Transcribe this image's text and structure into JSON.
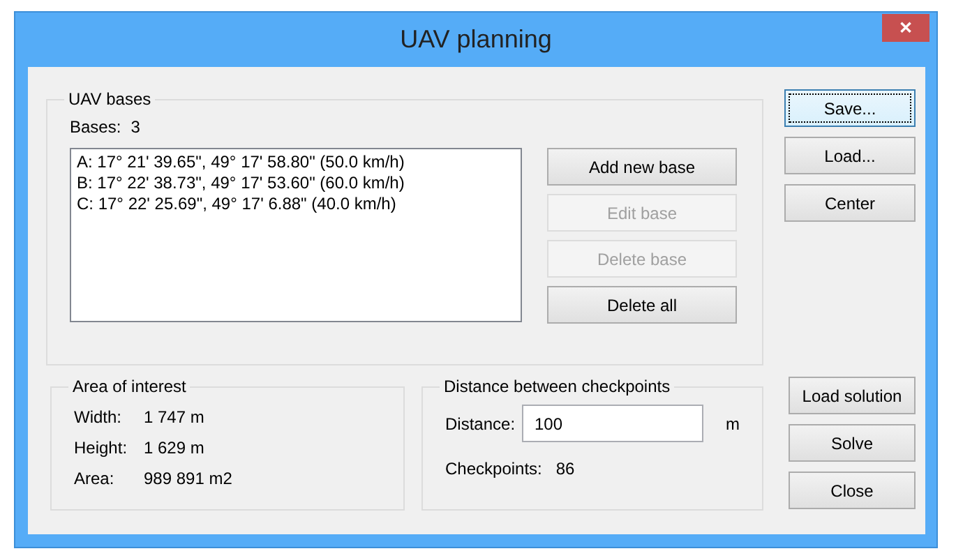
{
  "window": {
    "title": "UAV planning",
    "close": "✕"
  },
  "bases_group": {
    "title": "UAV bases",
    "count_label": "Bases:",
    "count": "3",
    "items": [
      "A: 17° 21' 39.65\", 49° 17' 58.80\" (50.0 km/h)",
      "B: 17° 22' 38.73\", 49° 17' 53.60\" (60.0 km/h)",
      "C: 17° 22' 25.69\", 49° 17' 6.88\" (40.0 km/h)"
    ],
    "buttons": [
      {
        "label": "Add new base",
        "disabled": false
      },
      {
        "label": "Edit base",
        "disabled": true
      },
      {
        "label": "Delete base",
        "disabled": true
      },
      {
        "label": "Delete all",
        "disabled": false
      }
    ]
  },
  "side_buttons": [
    {
      "label": "Save...",
      "focused": true
    },
    {
      "label": "Load...",
      "focused": false
    },
    {
      "label": "Center",
      "focused": false
    }
  ],
  "area_group": {
    "title": "Area of interest",
    "rows": [
      {
        "label": "Width:",
        "value": "1 747 m"
      },
      {
        "label": "Height:",
        "value": "1 629 m"
      },
      {
        "label": "Area:",
        "value": "989 891 m2"
      }
    ]
  },
  "distance_group": {
    "title": "Distance between checkpoints",
    "distance_label": "Distance:",
    "distance_value": "100",
    "unit": "m",
    "checkpoints_label": "Checkpoints:",
    "checkpoints_value": "86"
  },
  "bottom_buttons": [
    {
      "label": "Load solution",
      "focused": false
    },
    {
      "label": "Solve",
      "focused": false
    },
    {
      "label": "Close",
      "focused": false
    }
  ]
}
